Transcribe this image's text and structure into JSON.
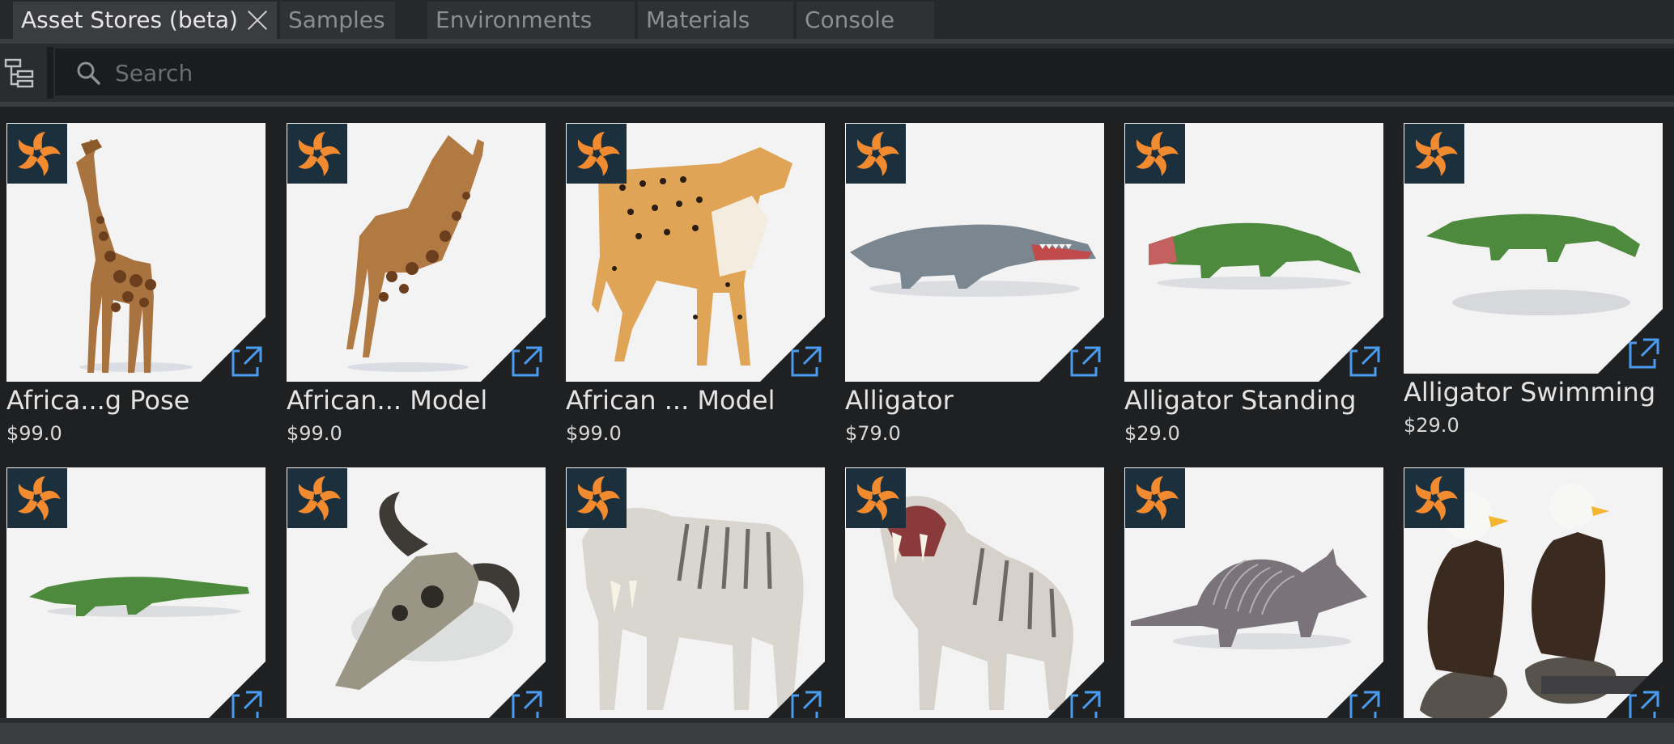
{
  "tabs": [
    {
      "label": "Asset Stores (beta)",
      "active": true
    },
    {
      "label": "Samples"
    },
    {
      "label": "Environments"
    },
    {
      "label": "Materials"
    },
    {
      "label": "Console"
    }
  ],
  "toolbar": {
    "tree_icon": "hierarchy-icon",
    "search_icon": "search-icon",
    "search_placeholder": "Search",
    "search_value": ""
  },
  "colors": {
    "accent_orange": "#f28a30",
    "badge_bg": "#1c2f3c",
    "link_blue": "#4a9cf0"
  },
  "assets": [
    {
      "title": "Africa...g Pose",
      "price": "$99.0",
      "art": "giraffe"
    },
    {
      "title": "African... Model",
      "price": "$99.0",
      "art": "giraffe-walk"
    },
    {
      "title": "African ... Model",
      "price": "$99.0",
      "art": "cheetah"
    },
    {
      "title": "Alligator",
      "price": "$79.0",
      "art": "alligator-gray"
    },
    {
      "title": "Alligator Standing",
      "price": "$29.0",
      "art": "alligator-green"
    },
    {
      "title": "Alligator Swimming",
      "price": "$29.0",
      "art": "alligator-swim"
    },
    {
      "title": "",
      "price": "",
      "art": "alligator-flat"
    },
    {
      "title": "",
      "price": "",
      "art": "skull"
    },
    {
      "title": "",
      "price": "",
      "art": "sabertooth"
    },
    {
      "title": "",
      "price": "",
      "art": "sabertooth-roar"
    },
    {
      "title": "",
      "price": "",
      "art": "armadillo"
    },
    {
      "title": "",
      "price": "",
      "art": "eagles"
    }
  ]
}
